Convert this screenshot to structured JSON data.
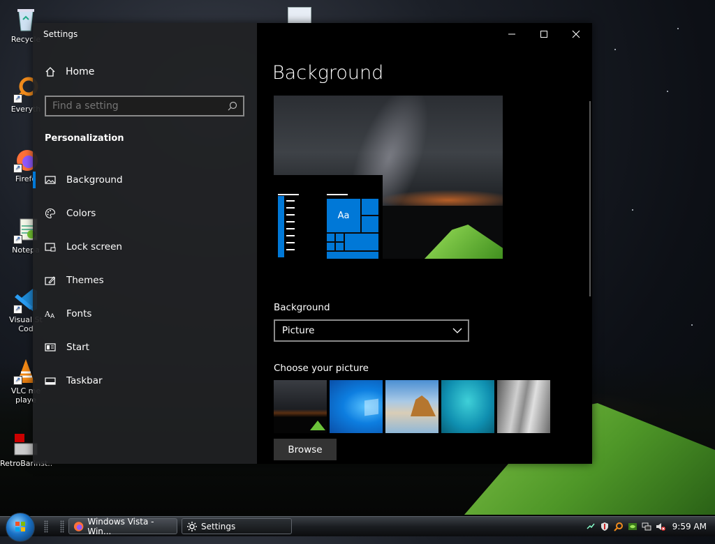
{
  "desktop": {
    "icons": [
      {
        "label": "Recycle",
        "icon": "recycle-bin-icon"
      },
      {
        "label": "Everyth",
        "icon": "everything-icon"
      },
      {
        "label": "Firefo",
        "icon": "firefox-icon"
      },
      {
        "label": "Notepa",
        "icon": "notepad-icon"
      },
      {
        "label": "Visual St",
        "label2": "Cod",
        "icon": "vscode-icon"
      },
      {
        "label": "VLC me",
        "label2": "playe",
        "icon": "vlc-icon"
      },
      {
        "label": "RetroBarInst...",
        "icon": "retrobar-installer-icon"
      }
    ]
  },
  "window": {
    "title": "Settings",
    "controls": {
      "minimize": "—",
      "maximize": "☐",
      "close": "✕"
    }
  },
  "sidebar": {
    "home_label": "Home",
    "search_placeholder": "Find a setting",
    "section_title": "Personalization",
    "items": [
      {
        "label": "Background",
        "icon": "picture-icon",
        "selected": true
      },
      {
        "label": "Colors",
        "icon": "palette-icon",
        "selected": false
      },
      {
        "label": "Lock screen",
        "icon": "lock-screen-icon",
        "selected": false
      },
      {
        "label": "Themes",
        "icon": "themes-icon",
        "selected": false
      },
      {
        "label": "Fonts",
        "icon": "fonts-icon",
        "selected": false
      },
      {
        "label": "Start",
        "icon": "start-icon",
        "selected": false
      },
      {
        "label": "Taskbar",
        "icon": "taskbar-icon",
        "selected": false
      }
    ]
  },
  "content": {
    "title": "Background",
    "preview_tile_text": "Aa",
    "background_label": "Background",
    "background_value": "Picture",
    "choose_label": "Choose your picture",
    "browse_label": "Browse"
  },
  "taskbar": {
    "buttons": [
      {
        "label": "Windows Vista - Win...",
        "icon": "firefox-icon",
        "active": false
      },
      {
        "label": "Settings",
        "icon": "gear-icon",
        "active": true
      }
    ],
    "clock": "9:59 AM"
  },
  "colors": {
    "accent": "#0078d7",
    "sidebar_bg": "#202123",
    "content_bg": "#000000"
  }
}
